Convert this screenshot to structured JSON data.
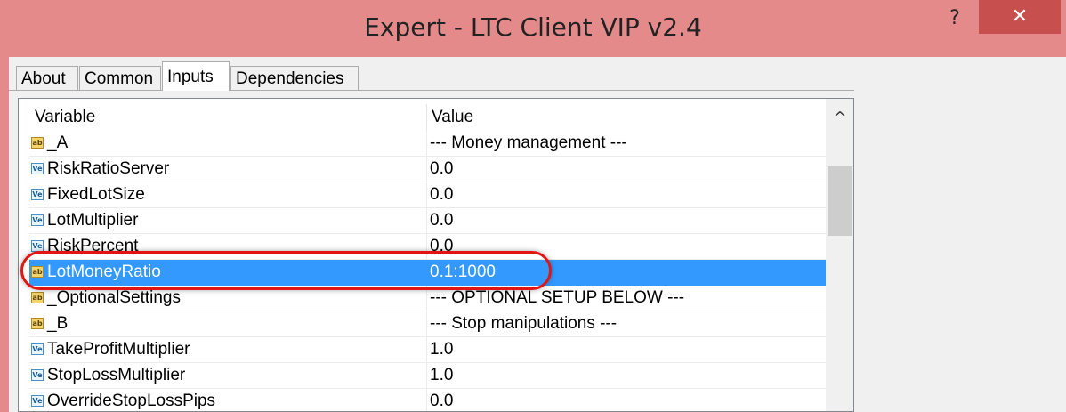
{
  "window": {
    "title": "Expert - LTC Client VIP v2.4",
    "help_label": "?",
    "close_label": "✕"
  },
  "tabs": [
    {
      "label": "About",
      "active": false
    },
    {
      "label": "Common",
      "active": false
    },
    {
      "label": "Inputs",
      "active": true
    },
    {
      "label": "Dependencies",
      "active": false
    }
  ],
  "columns": {
    "variable": "Variable",
    "value": "Value"
  },
  "rows": [
    {
      "icon": "ab",
      "variable": "_A",
      "value": "--- Money management ---"
    },
    {
      "icon": "ve",
      "variable": "RiskRatioServer",
      "value": "0.0"
    },
    {
      "icon": "ve",
      "variable": "FixedLotSize",
      "value": "0.0"
    },
    {
      "icon": "ve",
      "variable": "LotMultiplier",
      "value": "0.0"
    },
    {
      "icon": "ve",
      "variable": "RiskPercent",
      "value": "0.0"
    },
    {
      "icon": "ab",
      "variable": "LotMoneyRatio",
      "value": "0.1:1000",
      "selected": true
    },
    {
      "icon": "ab",
      "variable": "_OptionalSettings",
      "value": "--- OPTIONAL SETUP BELOW ---"
    },
    {
      "icon": "ab",
      "variable": "_B",
      "value": "--- Stop manipulations ---"
    },
    {
      "icon": "ve",
      "variable": "TakeProfitMultiplier",
      "value": "1.0"
    },
    {
      "icon": "ve",
      "variable": "StopLossMultiplier",
      "value": "1.0"
    },
    {
      "icon": "ve",
      "variable": "OverrideStopLossPips",
      "value": "0.0"
    }
  ],
  "scrollbar": {
    "up_arrow": "^"
  },
  "icon_glyphs": {
    "ab": "ab",
    "ve": "Ve"
  },
  "colors": {
    "titlebar": "#e48a8a",
    "close": "#c7504f",
    "selection": "#3399ff",
    "annotation": "#e21414"
  }
}
